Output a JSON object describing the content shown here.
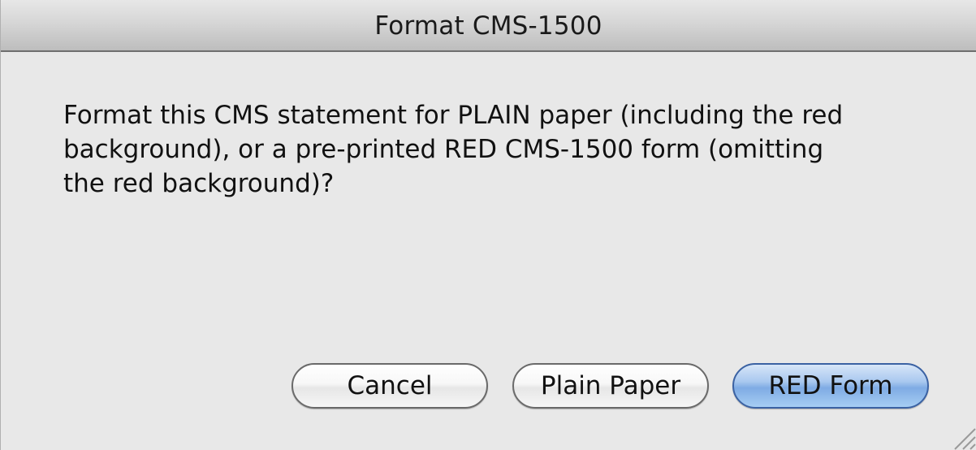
{
  "window": {
    "title": "Format CMS-1500"
  },
  "message": {
    "line1": "Format this CMS statement for PLAIN paper (including the red",
    "line2": "background), or a pre-printed RED CMS-1500 form (omitting",
    "line3": "the red background)?"
  },
  "buttons": {
    "cancel": "Cancel",
    "plain_paper": "Plain Paper",
    "red_form": "RED Form"
  },
  "colors": {
    "default_button_accent": "#7fabe4",
    "window_background": "#e8e8e8"
  }
}
